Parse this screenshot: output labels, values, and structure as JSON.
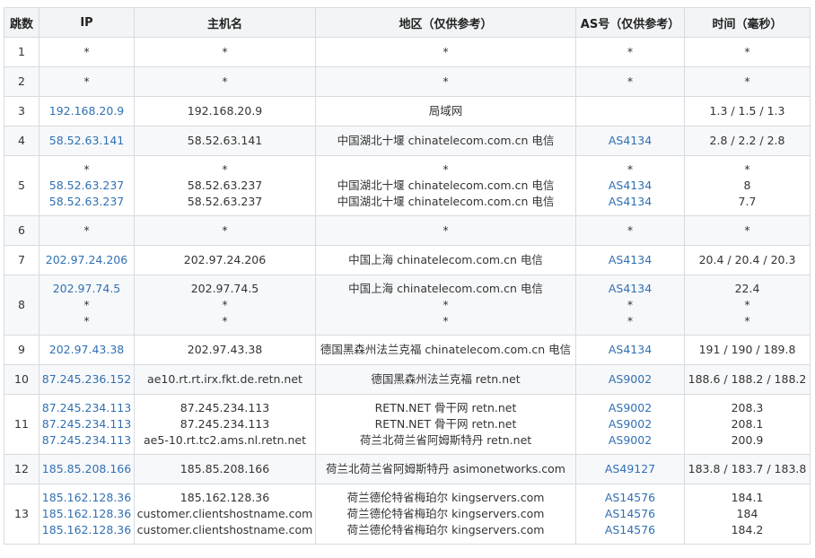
{
  "headers": [
    "跳数",
    "IP",
    "主机名",
    "地区（仅供参考）",
    "AS号（仅供参考）",
    "时间（毫秒）"
  ],
  "rows": [
    {
      "hop": "1",
      "ip": [
        "*"
      ],
      "host": [
        "*"
      ],
      "region": [
        "*"
      ],
      "as": [
        "*"
      ],
      "time": [
        "*"
      ]
    },
    {
      "hop": "2",
      "ip": [
        "*"
      ],
      "host": [
        "*"
      ],
      "region": [
        "*"
      ],
      "as": [
        "*"
      ],
      "time": [
        "*"
      ]
    },
    {
      "hop": "3",
      "ip": [
        "192.168.20.9"
      ],
      "host": [
        "192.168.20.9"
      ],
      "region": [
        "局域网"
      ],
      "as": [
        ""
      ],
      "time": [
        "1.3 / 1.5 / 1.3"
      ]
    },
    {
      "hop": "4",
      "ip": [
        "58.52.63.141"
      ],
      "host": [
        "58.52.63.141"
      ],
      "region": [
        "中国湖北十堰 chinatelecom.com.cn 电信"
      ],
      "as": [
        "AS4134"
      ],
      "time": [
        "2.8 / 2.2 / 2.8"
      ]
    },
    {
      "hop": "5",
      "ip": [
        "*",
        "58.52.63.237",
        "58.52.63.237"
      ],
      "host": [
        "*",
        "58.52.63.237",
        "58.52.63.237"
      ],
      "region": [
        "*",
        "中国湖北十堰 chinatelecom.com.cn 电信",
        "中国湖北十堰 chinatelecom.com.cn 电信"
      ],
      "as": [
        "*",
        "AS4134",
        "AS4134"
      ],
      "time": [
        "*",
        "8",
        "7.7"
      ]
    },
    {
      "hop": "6",
      "ip": [
        "*"
      ],
      "host": [
        "*"
      ],
      "region": [
        "*"
      ],
      "as": [
        "*"
      ],
      "time": [
        "*"
      ]
    },
    {
      "hop": "7",
      "ip": [
        "202.97.24.206"
      ],
      "host": [
        "202.97.24.206"
      ],
      "region": [
        "中国上海 chinatelecom.com.cn 电信"
      ],
      "as": [
        "AS4134"
      ],
      "time": [
        "20.4 / 20.4 / 20.3"
      ]
    },
    {
      "hop": "8",
      "ip": [
        "202.97.74.5",
        "*",
        "*"
      ],
      "host": [
        "202.97.74.5",
        "*",
        "*"
      ],
      "region": [
        "中国上海 chinatelecom.com.cn 电信",
        "*",
        "*"
      ],
      "as": [
        "AS4134",
        "*",
        "*"
      ],
      "time": [
        "22.4",
        "*",
        "*"
      ]
    },
    {
      "hop": "9",
      "ip": [
        "202.97.43.38"
      ],
      "host": [
        "202.97.43.38"
      ],
      "region": [
        "德国黑森州法兰克福 chinatelecom.com.cn 电信"
      ],
      "as": [
        "AS4134"
      ],
      "time": [
        "191 / 190 / 189.8"
      ]
    },
    {
      "hop": "10",
      "ip": [
        "87.245.236.152"
      ],
      "host": [
        "ae10.rt.rt.irx.fkt.de.retn.net"
      ],
      "region": [
        "德国黑森州法兰克福 retn.net"
      ],
      "as": [
        "AS9002"
      ],
      "time": [
        "188.6 / 188.2 / 188.2"
      ]
    },
    {
      "hop": "11",
      "ip": [
        "87.245.234.113",
        "87.245.234.113",
        "87.245.234.113"
      ],
      "host": [
        "87.245.234.113",
        "87.245.234.113",
        "ae5-10.rt.tc2.ams.nl.retn.net"
      ],
      "region": [
        "RETN.NET 骨干网 retn.net",
        "RETN.NET 骨干网 retn.net",
        "荷兰北荷兰省阿姆斯特丹 retn.net"
      ],
      "as": [
        "AS9002",
        "AS9002",
        "AS9002"
      ],
      "time": [
        "208.3",
        "208.1",
        "200.9"
      ]
    },
    {
      "hop": "12",
      "ip": [
        "185.85.208.166"
      ],
      "host": [
        "185.85.208.166"
      ],
      "region": [
        "荷兰北荷兰省阿姆斯特丹 asimonetworks.com"
      ],
      "as": [
        "AS49127"
      ],
      "time": [
        "183.8 / 183.7 / 183.8"
      ]
    },
    {
      "hop": "13",
      "ip": [
        "185.162.128.36",
        "185.162.128.36",
        "185.162.128.36"
      ],
      "host": [
        "185.162.128.36",
        "customer.clientshostname.com",
        "customer.clientshostname.com"
      ],
      "region": [
        "荷兰德伦特省梅珀尔 kingservers.com",
        "荷兰德伦特省梅珀尔 kingservers.com",
        "荷兰德伦特省梅珀尔 kingservers.com"
      ],
      "as": [
        "AS14576",
        "AS14576",
        "AS14576"
      ],
      "time": [
        "184.1",
        "184",
        "184.2"
      ]
    }
  ]
}
